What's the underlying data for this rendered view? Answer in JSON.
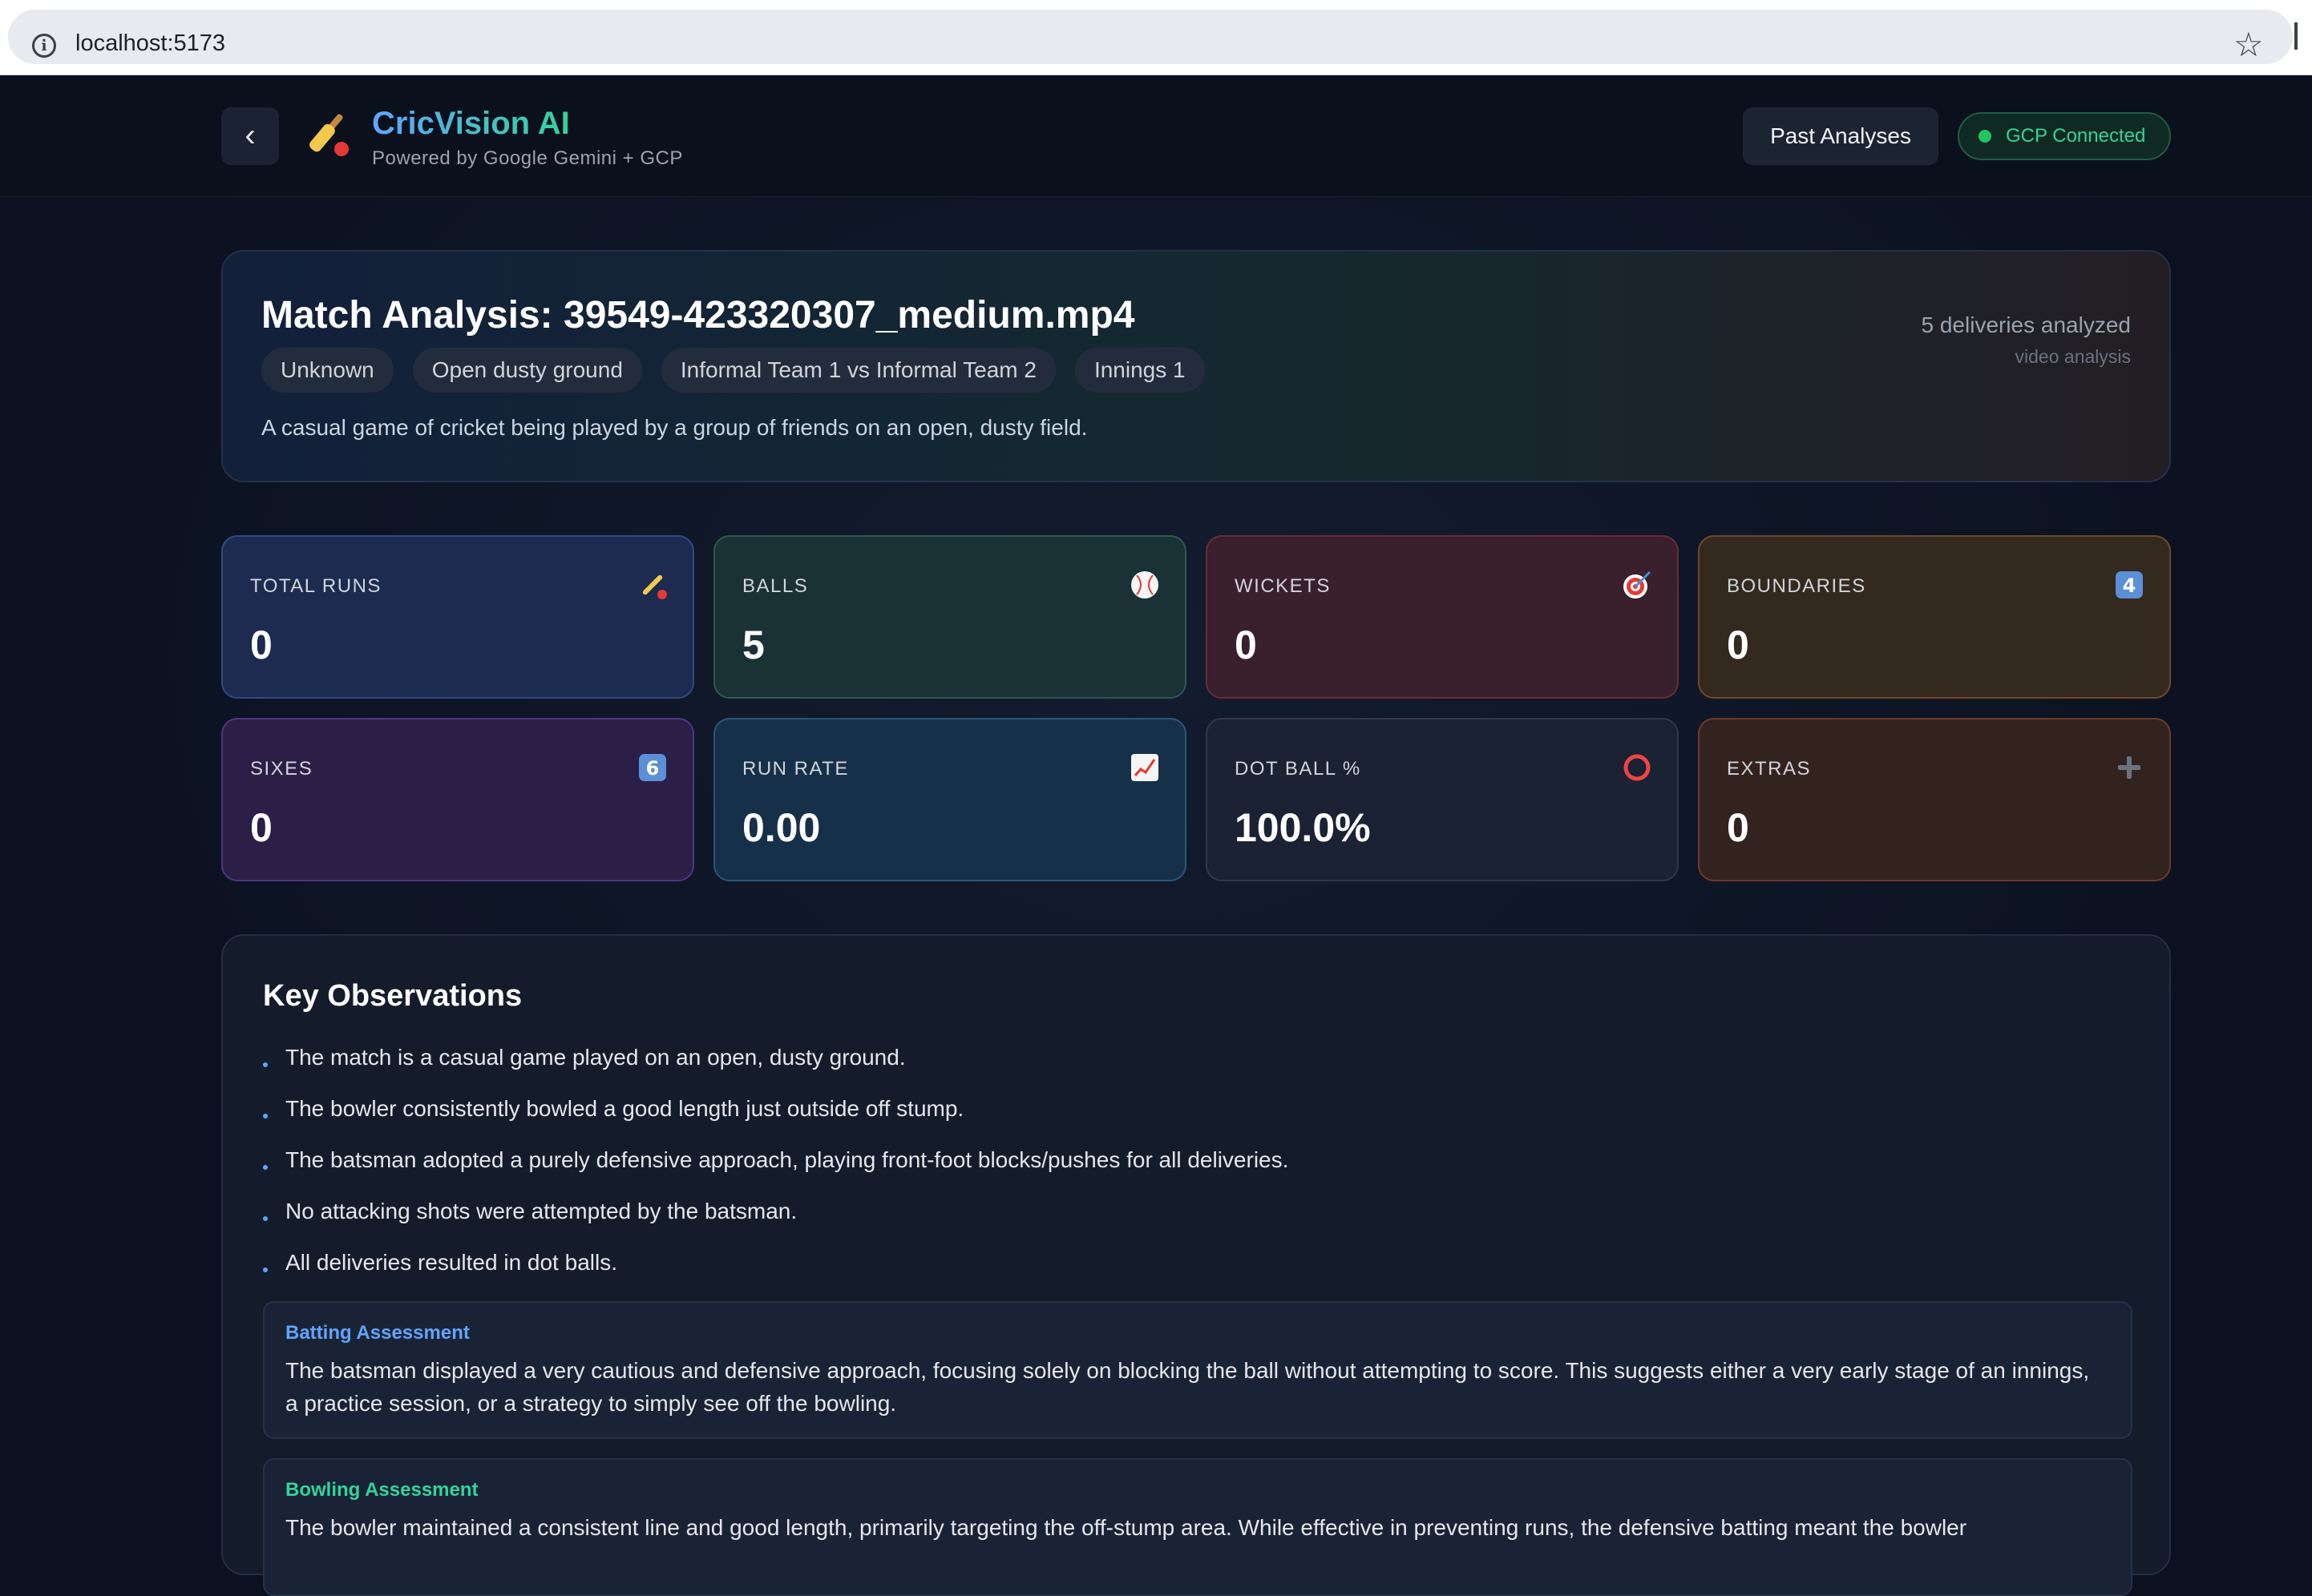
{
  "browser": {
    "url": "localhost:5173"
  },
  "header": {
    "back_label": "‹",
    "app_name": "CricVision AI",
    "tagline": "Powered by Google Gemini + GCP",
    "past_analyses_label": "Past Analyses",
    "gcp_status": "GCP Connected"
  },
  "match": {
    "title": "Match Analysis: 39549-423320307_medium.mp4",
    "tags": [
      "Unknown",
      "Open dusty ground",
      "Informal Team 1 vs Informal Team 2",
      "Innings 1"
    ],
    "description": "A casual game of cricket being played by a group of friends on an open, dusty field.",
    "deliveries_text": "5 deliveries analyzed",
    "analysis_type": "video analysis"
  },
  "stats": [
    {
      "label": "TOTAL RUNS",
      "value": "0",
      "icon": "cricket-bat-icon"
    },
    {
      "label": "BALLS",
      "value": "5",
      "icon": "ball-icon"
    },
    {
      "label": "WICKETS",
      "value": "0",
      "icon": "target-icon"
    },
    {
      "label": "BOUNDARIES",
      "value": "0",
      "icon": "four-icon"
    },
    {
      "label": "SIXES",
      "value": "0",
      "icon": "six-icon"
    },
    {
      "label": "RUN RATE",
      "value": "0.00",
      "icon": "chart-up-icon"
    },
    {
      "label": "DOT BALL %",
      "value": "100.0%",
      "icon": "circle-icon"
    },
    {
      "label": "EXTRAS",
      "value": "0",
      "icon": "plus-icon"
    }
  ],
  "observations": {
    "title": "Key Observations",
    "items": [
      "The match is a casual game played on an open, dusty ground.",
      "The bowler consistently bowled a good length just outside off stump.",
      "The batsman adopted a purely defensive approach, playing front-foot blocks/pushes for all deliveries.",
      "No attacking shots were attempted by the batsman.",
      "All deliveries resulted in dot balls."
    ],
    "batting": {
      "title": "Batting Assessment",
      "text": "The batsman displayed a very cautious and defensive approach, focusing solely on blocking the ball without attempting to score. This suggests either a very early stage of an innings, a practice session, or a strategy to simply see off the bowling."
    },
    "bowling": {
      "title": "Bowling Assessment",
      "text": "The bowler maintained a consistent line and good length, primarily targeting the off-stump area. While effective in preventing runs, the defensive batting meant the bowler"
    }
  },
  "colors": {
    "accent_blue": "#60a5fa",
    "accent_green": "#34d399",
    "status_green": "#22c55e",
    "background": "#0b1120"
  }
}
